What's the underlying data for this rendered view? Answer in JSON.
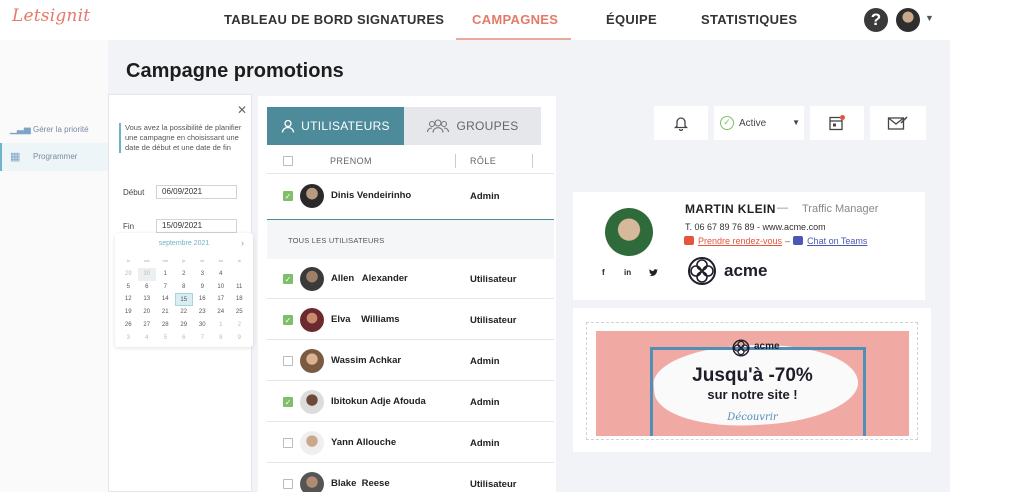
{
  "app": {
    "logo": "Letsignit"
  },
  "nav": {
    "items": [
      {
        "label": "TABLEAU DE BORD"
      },
      {
        "label": "SIGNATURES"
      },
      {
        "label": "CAMPAGNES"
      },
      {
        "label": "ÉQUIPE"
      },
      {
        "label": "STATISTIQUES"
      }
    ],
    "active": "CAMPAGNES",
    "help_icon": "question-circle-icon",
    "help_glyph": "?"
  },
  "page": {
    "title": "Campagne promotions"
  },
  "sidebar": {
    "items": [
      {
        "label": "Gérer la priorité",
        "icon": "priority-bars-icon",
        "glyph": "▁▃▅"
      },
      {
        "label": "Programmer",
        "icon": "calendar-icon",
        "glyph": "▦",
        "selected": true
      }
    ]
  },
  "schedule": {
    "description": "Vous avez la possibilité de planifier une campagne en choisissant une date de début et une date de fin",
    "start_label": "Début",
    "start_value": "06/09/2021",
    "end_label": "Fin",
    "end_value": "15/09/2021",
    "calendar": {
      "month_label": "septembre 2021",
      "weekdays": [
        "lu",
        "ma",
        "me",
        "je",
        "ve",
        "sa",
        "di"
      ],
      "weeks": [
        [
          "29",
          "30",
          "1",
          "2",
          "3",
          "4"
        ],
        [
          "5",
          "6",
          "7",
          "8",
          "9",
          "10",
          "11"
        ],
        [
          "12",
          "13",
          "14",
          "15",
          "16",
          "17",
          "18"
        ],
        [
          "19",
          "20",
          "21",
          "22",
          "23",
          "24",
          "25"
        ],
        [
          "26",
          "27",
          "28",
          "29",
          "30",
          "1",
          "2"
        ],
        [
          "3",
          "4",
          "5",
          "6",
          "7",
          "8",
          "9"
        ]
      ]
    }
  },
  "users": {
    "tab_users": "UTILISATEURS",
    "tab_groups": "GROUPES",
    "col_prenom": "PRENOM",
    "col_role": "RÔLE",
    "pinned": {
      "name": "Dinis Vendeirinho",
      "role": "Admin",
      "checked": true
    },
    "section_label": "TOUS LES UTILISATEURS",
    "rows": [
      {
        "name": "Allen   Alexander",
        "role": "Utilisateur",
        "checked": true
      },
      {
        "name": "Elva    Williams",
        "role": "Utilisateur",
        "checked": true
      },
      {
        "name": "Wassim Achkar",
        "role": "Admin",
        "checked": false
      },
      {
        "name": "Ibitokun Adje Afouda",
        "role": "Admin",
        "checked": true
      },
      {
        "name": "Yann Allouche",
        "role": "Admin",
        "checked": false
      },
      {
        "name": "Blake  Reese",
        "role": "Utilisateur",
        "checked": false
      }
    ]
  },
  "toolbar": {
    "bell_icon": "bell-icon",
    "status_label": "Active",
    "calendar_alert_icon": "calendar-alert-icon",
    "mail_icon": "envelope-signature-icon"
  },
  "signature": {
    "name": "MARTIN KLEIN",
    "dash": "—",
    "title": "Traffic Manager",
    "contact": "T. 06 67 89 76 89 -  www.acme.com",
    "link_meeting": "Prendre rendez-vous",
    "link_sep": "–",
    "link_teams": "Chat on Teams",
    "social": [
      "f",
      "in",
      "twitter"
    ],
    "brand": "acme"
  },
  "banner": {
    "brand": "acme",
    "headline": "Jusqu'à -70%",
    "subheadline": "sur notre site !",
    "cta": "Découvrir"
  },
  "colors": {
    "accent": "#e37a6a",
    "teal": "#4d8a9a",
    "check_green": "#7fbf6a",
    "link_red": "#e4553e",
    "link_blue": "#4b57b3",
    "banner_pink": "#f0a9a3"
  }
}
